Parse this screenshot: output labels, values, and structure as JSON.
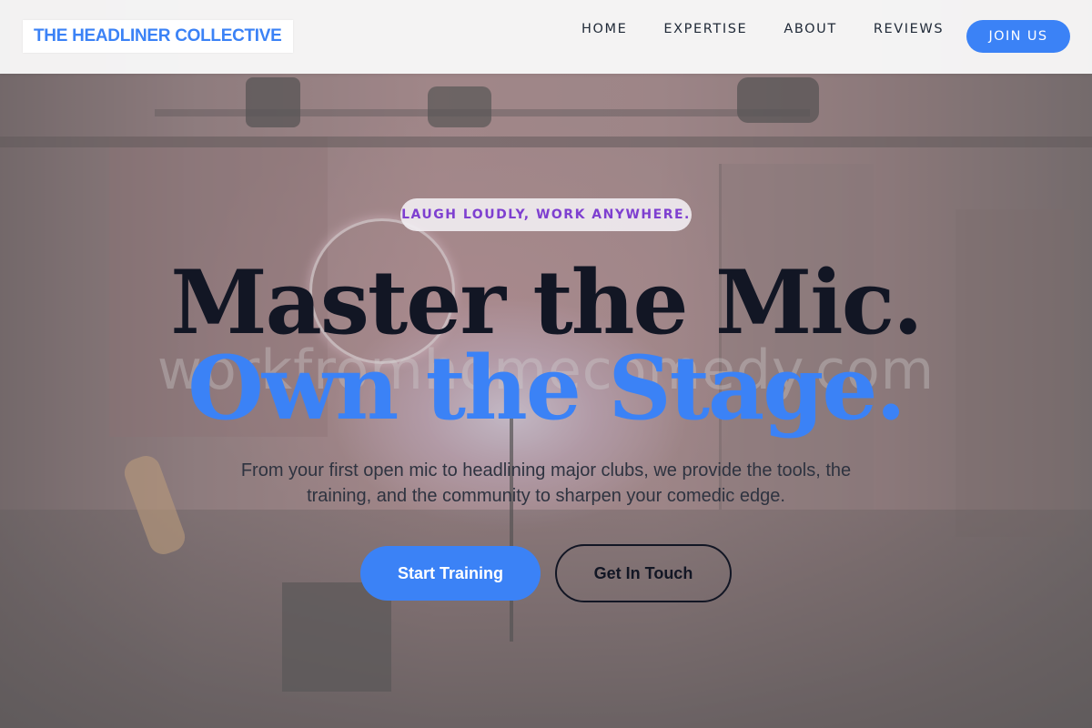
{
  "header": {
    "logo": "THE HEADLINER COLLECTIVE",
    "nav": [
      {
        "label": "HOME"
      },
      {
        "label": "EXPERTISE"
      },
      {
        "label": "ABOUT"
      },
      {
        "label": "REVIEWS"
      }
    ],
    "cta_label": "JOIN US"
  },
  "hero": {
    "tagline": "LAUGH LOUDLY, WORK ANYWHERE.",
    "headline_line1": "Master the Mic.",
    "headline_line2": "Own the Stage.",
    "subtext": "From your first open mic to headlining major clubs, we provide the tools, the training, and the community to sharpen your comedic edge.",
    "primary_button": "Start Training",
    "secondary_button": "Get In Touch",
    "background_watermark": "workfromhomecomedy.com"
  },
  "colors": {
    "accent": "#3b82f6",
    "headline_dark": "#121624",
    "tagline_text": "#7e3fd0"
  }
}
